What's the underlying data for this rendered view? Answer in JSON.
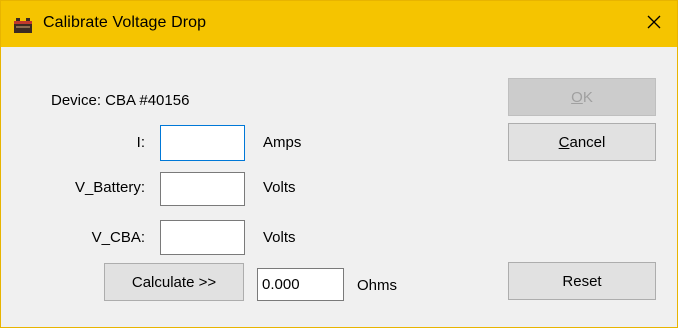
{
  "window": {
    "title": "Calibrate Voltage Drop",
    "titlebar_color": "#f5c400",
    "app_icon": "battery-icon",
    "close_icon": "close-icon"
  },
  "device": {
    "label": "Device: CBA #40156"
  },
  "fields": [
    {
      "label": "I:",
      "value": "",
      "unit": "Amps"
    },
    {
      "label": "V_Battery:",
      "value": "",
      "unit": "Volts"
    },
    {
      "label": "V_CBA:",
      "value": "",
      "unit": "Volts"
    }
  ],
  "calculate": {
    "button_label": "Calculate >>",
    "result_value": "0.000",
    "result_unit": "Ohms"
  },
  "buttons": {
    "ok": {
      "mnemonic": "O",
      "rest": "K",
      "enabled": false
    },
    "cancel": {
      "mnemonic": "C",
      "rest": "ancel"
    },
    "reset": "Reset"
  }
}
